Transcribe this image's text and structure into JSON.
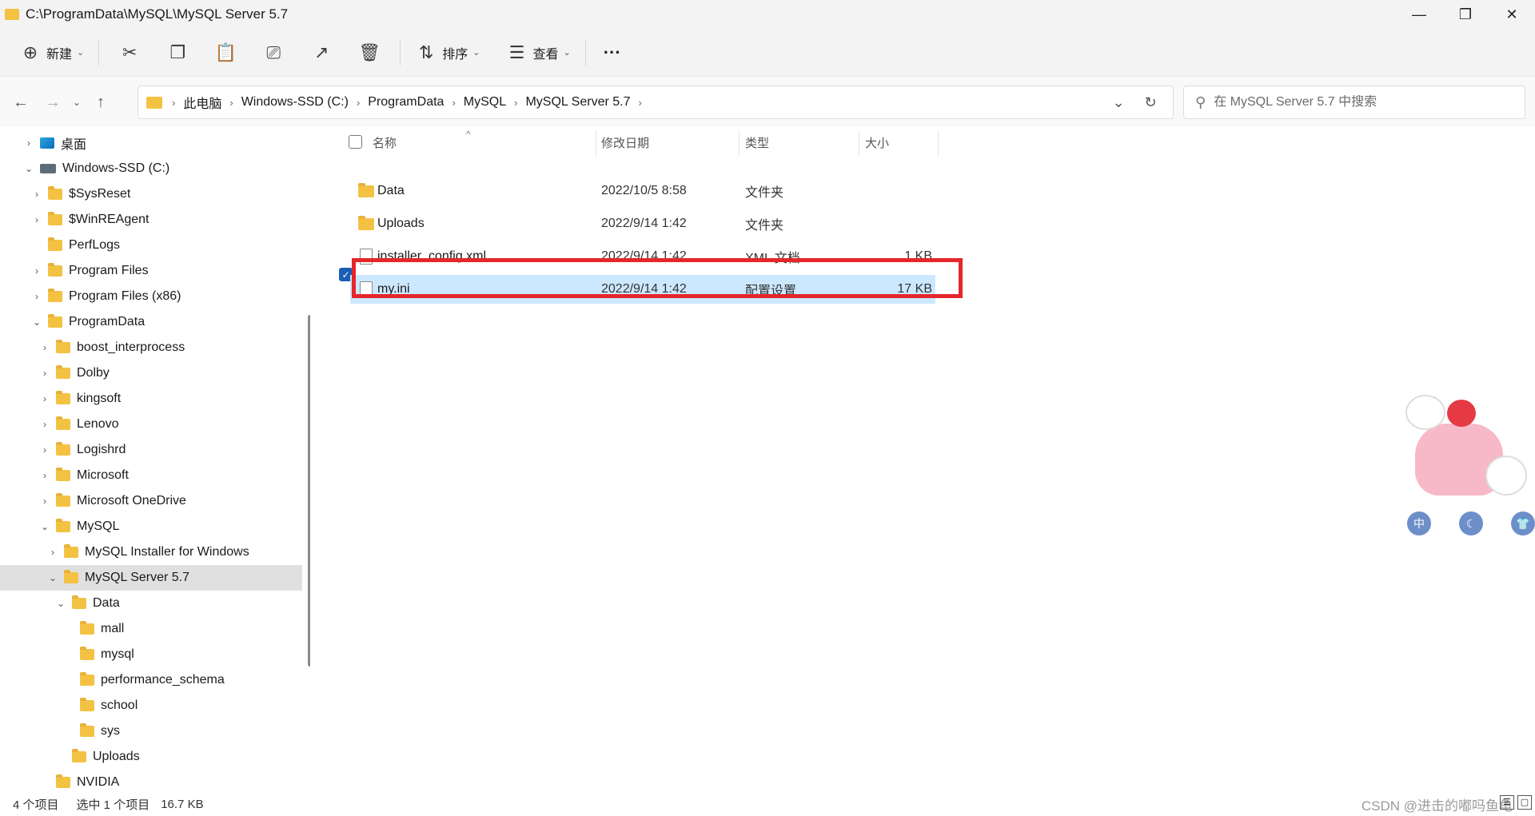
{
  "window": {
    "title": "C:\\ProgramData\\MySQL\\MySQL Server 5.7",
    "controls": [
      "minimize",
      "restore",
      "close"
    ]
  },
  "toolbar": {
    "new_label": "新建",
    "sort_label": "排序",
    "view_label": "查看",
    "more_label": "···"
  },
  "address": {
    "crumbs": [
      "此电脑",
      "Windows-SSD (C:)",
      "ProgramData",
      "MySQL",
      "MySQL Server 5.7"
    ]
  },
  "search": {
    "placeholder": "在 MySQL Server 5.7 中搜索"
  },
  "sidebar": {
    "items": [
      {
        "label": "桌面",
        "chevron": "›",
        "icon": "desktop-icon"
      },
      {
        "label": "Windows-SSD (C:)",
        "chevron": "⌄",
        "icon": "drive-icon"
      },
      {
        "label": "$SysReset",
        "chevron": "›",
        "icon": "folder-icon"
      },
      {
        "label": "$WinREAgent",
        "chevron": "›",
        "icon": "folder-icon"
      },
      {
        "label": "PerfLogs",
        "chevron": "",
        "icon": "folder-icon"
      },
      {
        "label": "Program Files",
        "chevron": "›",
        "icon": "folder-icon"
      },
      {
        "label": "Program Files (x86)",
        "chevron": "›",
        "icon": "folder-icon"
      },
      {
        "label": "ProgramData",
        "chevron": "⌄",
        "icon": "folder-icon"
      },
      {
        "label": "boost_interprocess",
        "chevron": "›",
        "icon": "folder-icon"
      },
      {
        "label": "Dolby",
        "chevron": "›",
        "icon": "folder-icon"
      },
      {
        "label": "kingsoft",
        "chevron": "›",
        "icon": "folder-icon"
      },
      {
        "label": "Lenovo",
        "chevron": "›",
        "icon": "folder-icon"
      },
      {
        "label": "Logishrd",
        "chevron": "›",
        "icon": "folder-icon"
      },
      {
        "label": "Microsoft",
        "chevron": "›",
        "icon": "folder-icon"
      },
      {
        "label": "Microsoft OneDrive",
        "chevron": "›",
        "icon": "folder-icon"
      },
      {
        "label": "MySQL",
        "chevron": "⌄",
        "icon": "folder-icon"
      },
      {
        "label": "MySQL Installer for Windows",
        "chevron": "›",
        "icon": "folder-icon"
      },
      {
        "label": "MySQL Server 5.7",
        "chevron": "⌄",
        "icon": "folder-icon"
      },
      {
        "label": "Data",
        "chevron": "⌄",
        "icon": "folder-icon"
      },
      {
        "label": "mall",
        "chevron": "",
        "icon": "folder-icon"
      },
      {
        "label": "mysql",
        "chevron": "",
        "icon": "folder-icon"
      },
      {
        "label": "performance_schema",
        "chevron": "",
        "icon": "folder-icon"
      },
      {
        "label": "school",
        "chevron": "",
        "icon": "folder-icon"
      },
      {
        "label": "sys",
        "chevron": "",
        "icon": "folder-icon"
      },
      {
        "label": "Uploads",
        "chevron": "",
        "icon": "folder-icon"
      },
      {
        "label": "NVIDIA",
        "chevron": "",
        "icon": "folder-icon"
      }
    ]
  },
  "columns": {
    "name": "名称",
    "date": "修改日期",
    "type": "类型",
    "size": "大小",
    "sort_indicator": "^"
  },
  "files": [
    {
      "name": "Data",
      "date": "2022/10/5 8:58",
      "type": "文件夹",
      "size": "",
      "icon": "folder-icon"
    },
    {
      "name": "Uploads",
      "date": "2022/9/14 1:42",
      "type": "文件夹",
      "size": "",
      "icon": "folder-icon"
    },
    {
      "name": "installer_config.xml",
      "date": "2022/9/14 1:42",
      "type": "XML 文档",
      "size": "1 KB",
      "icon": "file-icon"
    },
    {
      "name": "my.ini",
      "date": "2022/9/14 1:42",
      "type": "配置设置",
      "size": "17 KB",
      "icon": "config-file-icon",
      "selected": true
    }
  ],
  "status": {
    "count": "4 个项目",
    "selection": "选中 1 个项目",
    "size": "16.7 KB"
  },
  "watermark": "CSDN @进击的嘟吗鱼龟",
  "mascot_buttons": [
    "中",
    "☾",
    "👕"
  ]
}
